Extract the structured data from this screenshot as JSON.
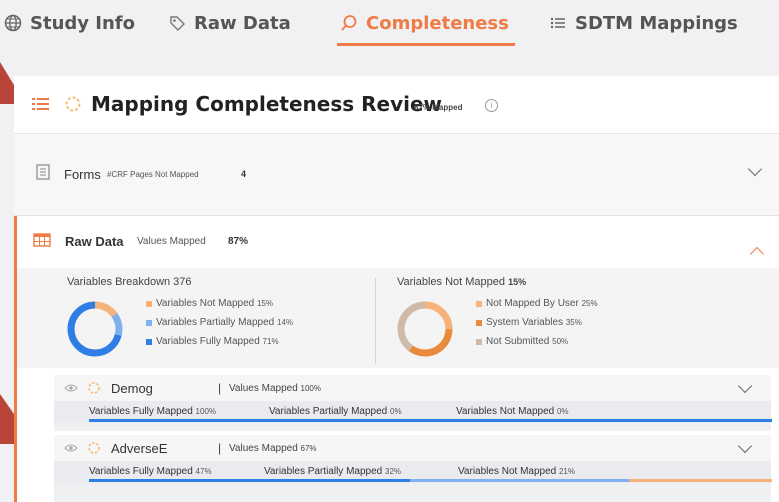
{
  "tabs": [
    {
      "label": "Study Info",
      "icon": "globe-icon"
    },
    {
      "label": "Raw Data",
      "icon": "tag-icon"
    },
    {
      "label": "Completeness",
      "icon": "search-icon",
      "active": true
    },
    {
      "label": "SDTM Mappings",
      "icon": "list-icon"
    }
  ],
  "header": {
    "title": "Mapping Completeness Review",
    "badge": "87% Mapped",
    "info": "i"
  },
  "forms": {
    "label": "Forms",
    "sub": "#CRF Pages Not Mapped",
    "count": "4"
  },
  "raw": {
    "label": "Raw Data",
    "sub": "Values Mapped",
    "value": "87%"
  },
  "breakdown": {
    "left": {
      "title": "Variables Breakdown 376",
      "items": [
        {
          "label": "Variables Not Mapped",
          "value": "15%",
          "color": "#f5b27a",
          "fraction": 0.15
        },
        {
          "label": "Variables Partially Mapped",
          "value": "14%",
          "color": "#7fb0ef",
          "fraction": 0.14
        },
        {
          "label": "Variables Fully Mapped",
          "value": "71%",
          "color": "#2f7ee6",
          "fraction": 0.71
        }
      ]
    },
    "right": {
      "title": "Variables Not Mapped",
      "title_value": "15%",
      "items": [
        {
          "label": "Not Mapped By User",
          "value": "25%",
          "color": "#f5b27a",
          "fraction": 0.25
        },
        {
          "label": "System Variables",
          "value": "35%",
          "color": "#e98a3c",
          "fraction": 0.35
        },
        {
          "label": "Not Submitted",
          "value": "50%",
          "color": "#cdbba8",
          "fraction": 0.5
        }
      ]
    }
  },
  "datasets": [
    {
      "name": "Demog",
      "values_mapped_label": "Values Mapped",
      "values_mapped": "100%",
      "stats": [
        {
          "label": "Variables Fully Mapped",
          "value": "100%"
        },
        {
          "label": "Variables Partially Mapped",
          "value": "0%"
        },
        {
          "label": "Variables Not Mapped",
          "value": "0%"
        }
      ],
      "fractions": {
        "full": 1.0,
        "partial": 0.0,
        "none": 0.0
      }
    },
    {
      "name": "AdverseE",
      "values_mapped_label": "Values Mapped",
      "values_mapped": "67%",
      "stats": [
        {
          "label": "Variables Fully Mapped",
          "value": "47%"
        },
        {
          "label": "Variables Partially Mapped",
          "value": "32%"
        },
        {
          "label": "Variables Not Mapped",
          "value": "21%"
        }
      ],
      "fractions": {
        "full": 0.47,
        "partial": 0.32,
        "none": 0.21
      }
    }
  ],
  "colors": {
    "accent": "#ef7b45",
    "full": "#2f7ee6",
    "partial": "#7fb0ef",
    "none": "#f5b27a"
  }
}
